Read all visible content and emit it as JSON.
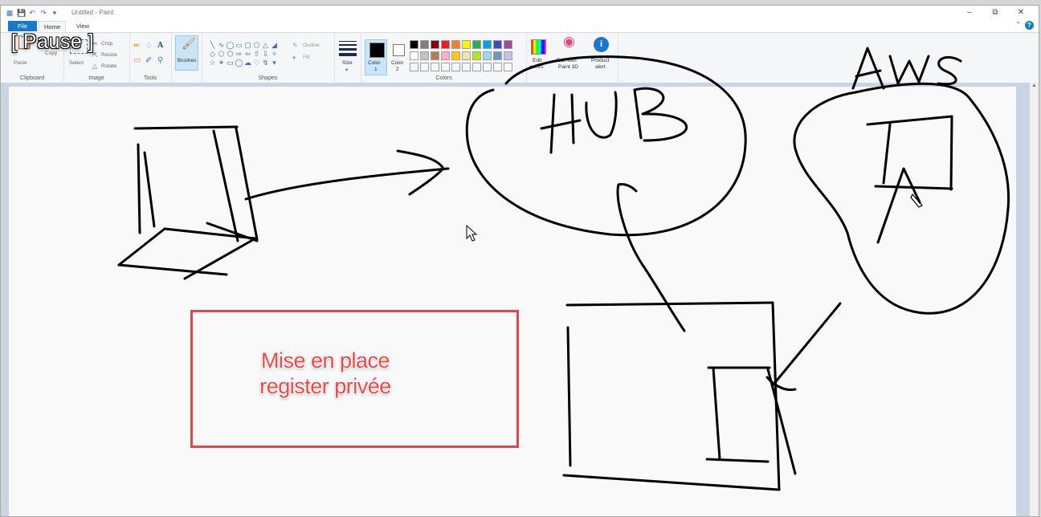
{
  "window": {
    "title": "Untitled - Paint"
  },
  "tabs": {
    "file": "File",
    "home": "Home",
    "view": "View"
  },
  "ribbon": {
    "clipboard": {
      "paste": "Paste",
      "cut": "Cut",
      "copy": "Copy",
      "label": "Clipboard"
    },
    "image": {
      "select": "Select",
      "crop": "Crop",
      "resize": "Resize",
      "rotate": "Rotate",
      "label": "Image"
    },
    "tools": {
      "label": "Tools"
    },
    "brushes": {
      "label": "Brushes"
    },
    "shapes": {
      "outline": "Outline",
      "fill": "Fill",
      "label": "Shapes"
    },
    "size": {
      "label": "Size"
    },
    "color1": {
      "label": "Color",
      "num": "1",
      "value": "#000000"
    },
    "color2": {
      "label": "Color",
      "num": "2",
      "value": "#ffffff"
    },
    "colors": {
      "label": "Colors",
      "palette": [
        "#000000",
        "#7f7f7f",
        "#880015",
        "#ed1c24",
        "#ff7f27",
        "#fff200",
        "#22b14c",
        "#00a2e8",
        "#3f48cc",
        "#a349a4",
        "#ffffff",
        "#c3c3c3",
        "#b97a57",
        "#ffaec9",
        "#ffc90e",
        "#efe4b0",
        "#b5e61d",
        "#99d9ea",
        "#7092be",
        "#c8bfe7"
      ]
    },
    "edit_colors": {
      "line1": "Edit",
      "line2": "colors"
    },
    "paint3d": {
      "line1": "Edit with",
      "line2": "Paint 3D"
    },
    "product_alert": {
      "line1": "Product",
      "line2": "alert"
    }
  },
  "overlay": {
    "pause": "[ Pause ]"
  },
  "drawing": {
    "hub_label": "HUB",
    "aws_label": "AWS",
    "note_line1": "Mise en place",
    "note_line2": "register privée",
    "note_color": "#e84a4a"
  }
}
